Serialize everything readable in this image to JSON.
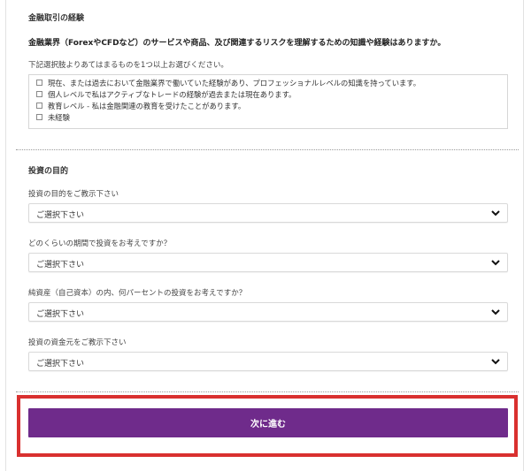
{
  "experience": {
    "title": "金融取引の経験",
    "question": "金融業界（ForexやCFDなど）のサービスや商品、及び関連するリスクを理解するための知識や経験はありますか。",
    "instruction": "下記選択肢よりあてはまるものを1つ以上お選びください。",
    "options": [
      "現在、または過去において金融業界で働いていた経験があり、プロフェッショナルレベルの知識を持っています。",
      "個人レベルで私はアクティブなトレードの経験が過去または現在あります。",
      "教育レベル - 私は金融関連の教育を受けたことがあります。",
      "未経験"
    ]
  },
  "investment": {
    "title": "投資の目的",
    "fields": [
      {
        "label": "投資の目的をご教示下さい",
        "value": "ご選択下さい"
      },
      {
        "label": "どのくらいの期間で投資をお考えですか？",
        "value": "ご選択下さい"
      },
      {
        "label": "純資産（自己資本）の内、何パーセントの投資をお考えですか？",
        "value": "ご選択下さい"
      },
      {
        "label": "投資の資金元をご教示下さい",
        "value": "ご選択下さい"
      }
    ]
  },
  "next_button": {
    "label": "次に進む"
  },
  "colors": {
    "button": "#6f2b8b",
    "highlight": "#d9302f"
  },
  "icons": {
    "checkbox": "checkbox-icon",
    "dropdown": "chevron-down-icon"
  }
}
